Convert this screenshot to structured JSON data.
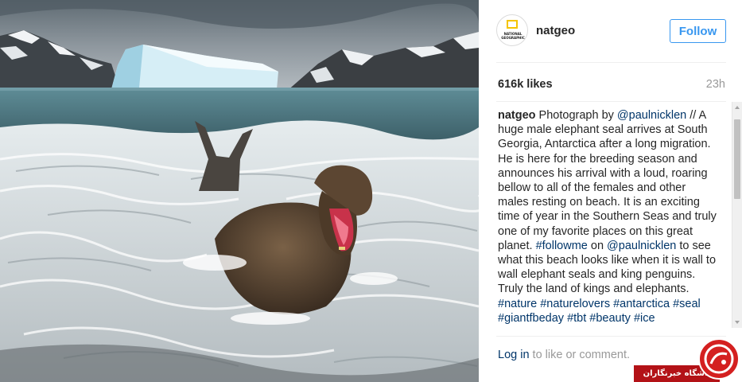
{
  "post": {
    "username": "natgeo",
    "avatar_text": "NATIONAL GEOGRAPHIC",
    "follow_label": "Follow",
    "likes": "616k likes",
    "time_ago": "23h",
    "caption": {
      "username": "natgeo",
      "t1": " Photograph by ",
      "mention1": "@paulnicklen",
      "t2": " // A huge male elephant seal arrives at South Georgia, Antarctica after a long migration. He is here for the breeding season and announces his arrival with a loud, roaring bellow to all of the females and other males resting on beach. It is an exciting time of year in the Southern Seas and truly one of my favorite places on this great planet. ",
      "hashtag1": "#followme",
      "t3": " on ",
      "mention2": "@paulnicklen",
      "t4": " to see what this beach looks like when it is wall to wall elephant seals and king penguins. Truly the land of kings and elephants. ",
      "hashtag2": "#nature",
      "hashtag3": "#naturelovers",
      "hashtag4": "#antarctica",
      "hashtag5": "#seal",
      "hashtag6": "#giantfbeday",
      "hashtag7": "#tbt",
      "hashtag8": "#beauty",
      "hashtag9": "#ice"
    },
    "login_link": "Log in",
    "login_rest": " to like or comment."
  },
  "photo": {
    "icon": "elephant-seal-photo"
  },
  "watermark": {
    "text": "باشگاه خبرنگاران"
  },
  "colors": {
    "link": "#003569",
    "follow": "#3897f0",
    "muted": "#999999",
    "watermark": "#b31217"
  }
}
